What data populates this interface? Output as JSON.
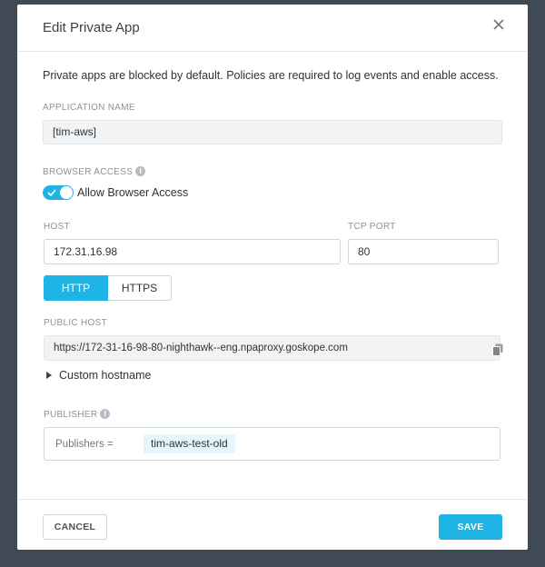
{
  "modal": {
    "title": "Edit Private App",
    "close_icon": "close-icon",
    "description": "Private apps are blocked by default. Policies are required to log events and enable access."
  },
  "app_name": {
    "label": "APPLICATION NAME",
    "value": "[tim-aws]"
  },
  "browser_access": {
    "label": "BROWSER ACCESS",
    "info_icon": "info-icon",
    "toggle_on": true,
    "toggle_label": "Allow Browser Access"
  },
  "host": {
    "label": "HOST",
    "value": "172.31.16.98"
  },
  "tcp_port": {
    "label": "TCP PORT",
    "value": "80"
  },
  "protocol": {
    "options": [
      "HTTP",
      "HTTPS"
    ],
    "selected": "HTTP"
  },
  "public_host": {
    "label": "PUBLIC HOST",
    "value": "https://172-31-16-98-80-nighthawk--eng.npaproxy.goskope.com",
    "copy_icon": "copy-icon"
  },
  "custom_hostname": {
    "label": "Custom hostname",
    "expanded": false
  },
  "publisher": {
    "label": "PUBLISHER",
    "info_icon": "info-icon",
    "prefix": "Publishers =",
    "chips": [
      "tim-aws-test-old"
    ]
  },
  "footer": {
    "cancel_label": "CANCEL",
    "save_label": "SAVE"
  },
  "colors": {
    "accent": "#1fb4e6",
    "backdrop": "#3f4a55",
    "chip_bg": "#e6f5fb"
  }
}
